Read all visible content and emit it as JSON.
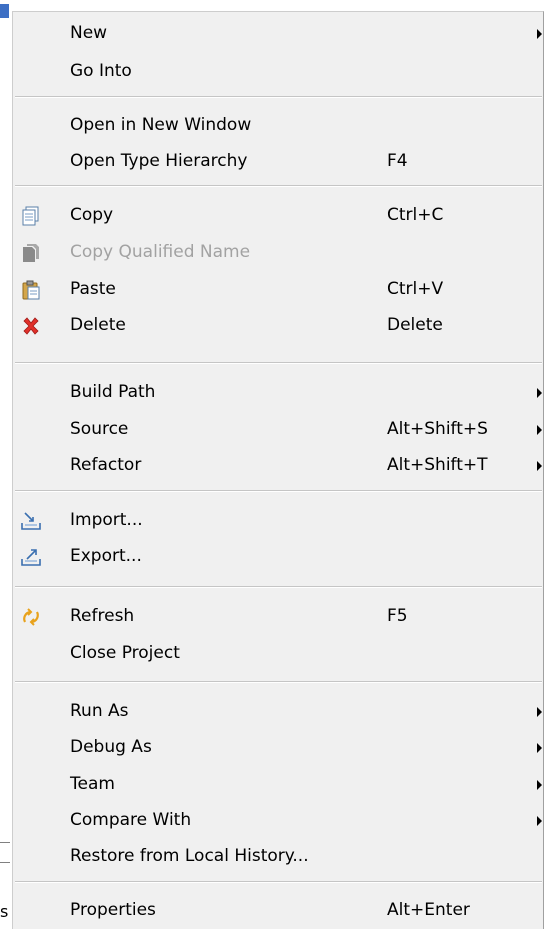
{
  "background": {
    "letter": "s"
  },
  "menu": {
    "items": [
      {
        "label": "New",
        "accel": "",
        "submenu": true,
        "icon": ""
      },
      {
        "label": "Go Into",
        "accel": "",
        "submenu": false,
        "icon": ""
      },
      {
        "label": "Open in New Window",
        "accel": "",
        "submenu": false,
        "icon": ""
      },
      {
        "label": "Open Type Hierarchy",
        "accel": "F4",
        "submenu": false,
        "icon": ""
      },
      {
        "label": "Copy",
        "accel": "Ctrl+C",
        "submenu": false,
        "icon": "copy-icon"
      },
      {
        "label": "Copy Qualified Name",
        "accel": "",
        "submenu": false,
        "icon": "copy-qualified-name-icon",
        "disabled": true
      },
      {
        "label": "Paste",
        "accel": "Ctrl+V",
        "submenu": false,
        "icon": "paste-icon"
      },
      {
        "label": "Delete",
        "accel": "Delete",
        "submenu": false,
        "icon": "delete-icon"
      },
      {
        "label": "Build Path",
        "accel": "",
        "submenu": true,
        "icon": ""
      },
      {
        "label": "Source",
        "accel": "Alt+Shift+S",
        "submenu": true,
        "icon": ""
      },
      {
        "label": "Refactor",
        "accel": "Alt+Shift+T",
        "submenu": true,
        "icon": ""
      },
      {
        "label": "Import...",
        "accel": "",
        "submenu": false,
        "icon": "import-icon"
      },
      {
        "label": "Export...",
        "accel": "",
        "submenu": false,
        "icon": "export-icon"
      },
      {
        "label": "Refresh",
        "accel": "F5",
        "submenu": false,
        "icon": "refresh-icon"
      },
      {
        "label": "Close Project",
        "accel": "",
        "submenu": false,
        "icon": ""
      },
      {
        "label": "Run As",
        "accel": "",
        "submenu": true,
        "icon": ""
      },
      {
        "label": "Debug As",
        "accel": "",
        "submenu": true,
        "icon": ""
      },
      {
        "label": "Team",
        "accel": "",
        "submenu": true,
        "icon": ""
      },
      {
        "label": "Compare With",
        "accel": "",
        "submenu": true,
        "icon": ""
      },
      {
        "label": "Restore from Local History...",
        "accel": "",
        "submenu": false,
        "icon": ""
      },
      {
        "label": "Properties",
        "accel": "Alt+Enter",
        "submenu": false,
        "icon": ""
      }
    ]
  },
  "colors": {
    "menu_bg": "#f0f0f0",
    "separator": "#c5c5c5",
    "disabled_text": "#a2a2a2",
    "delete_red": "#e0302a",
    "refresh_orange": "#e8a21c"
  }
}
